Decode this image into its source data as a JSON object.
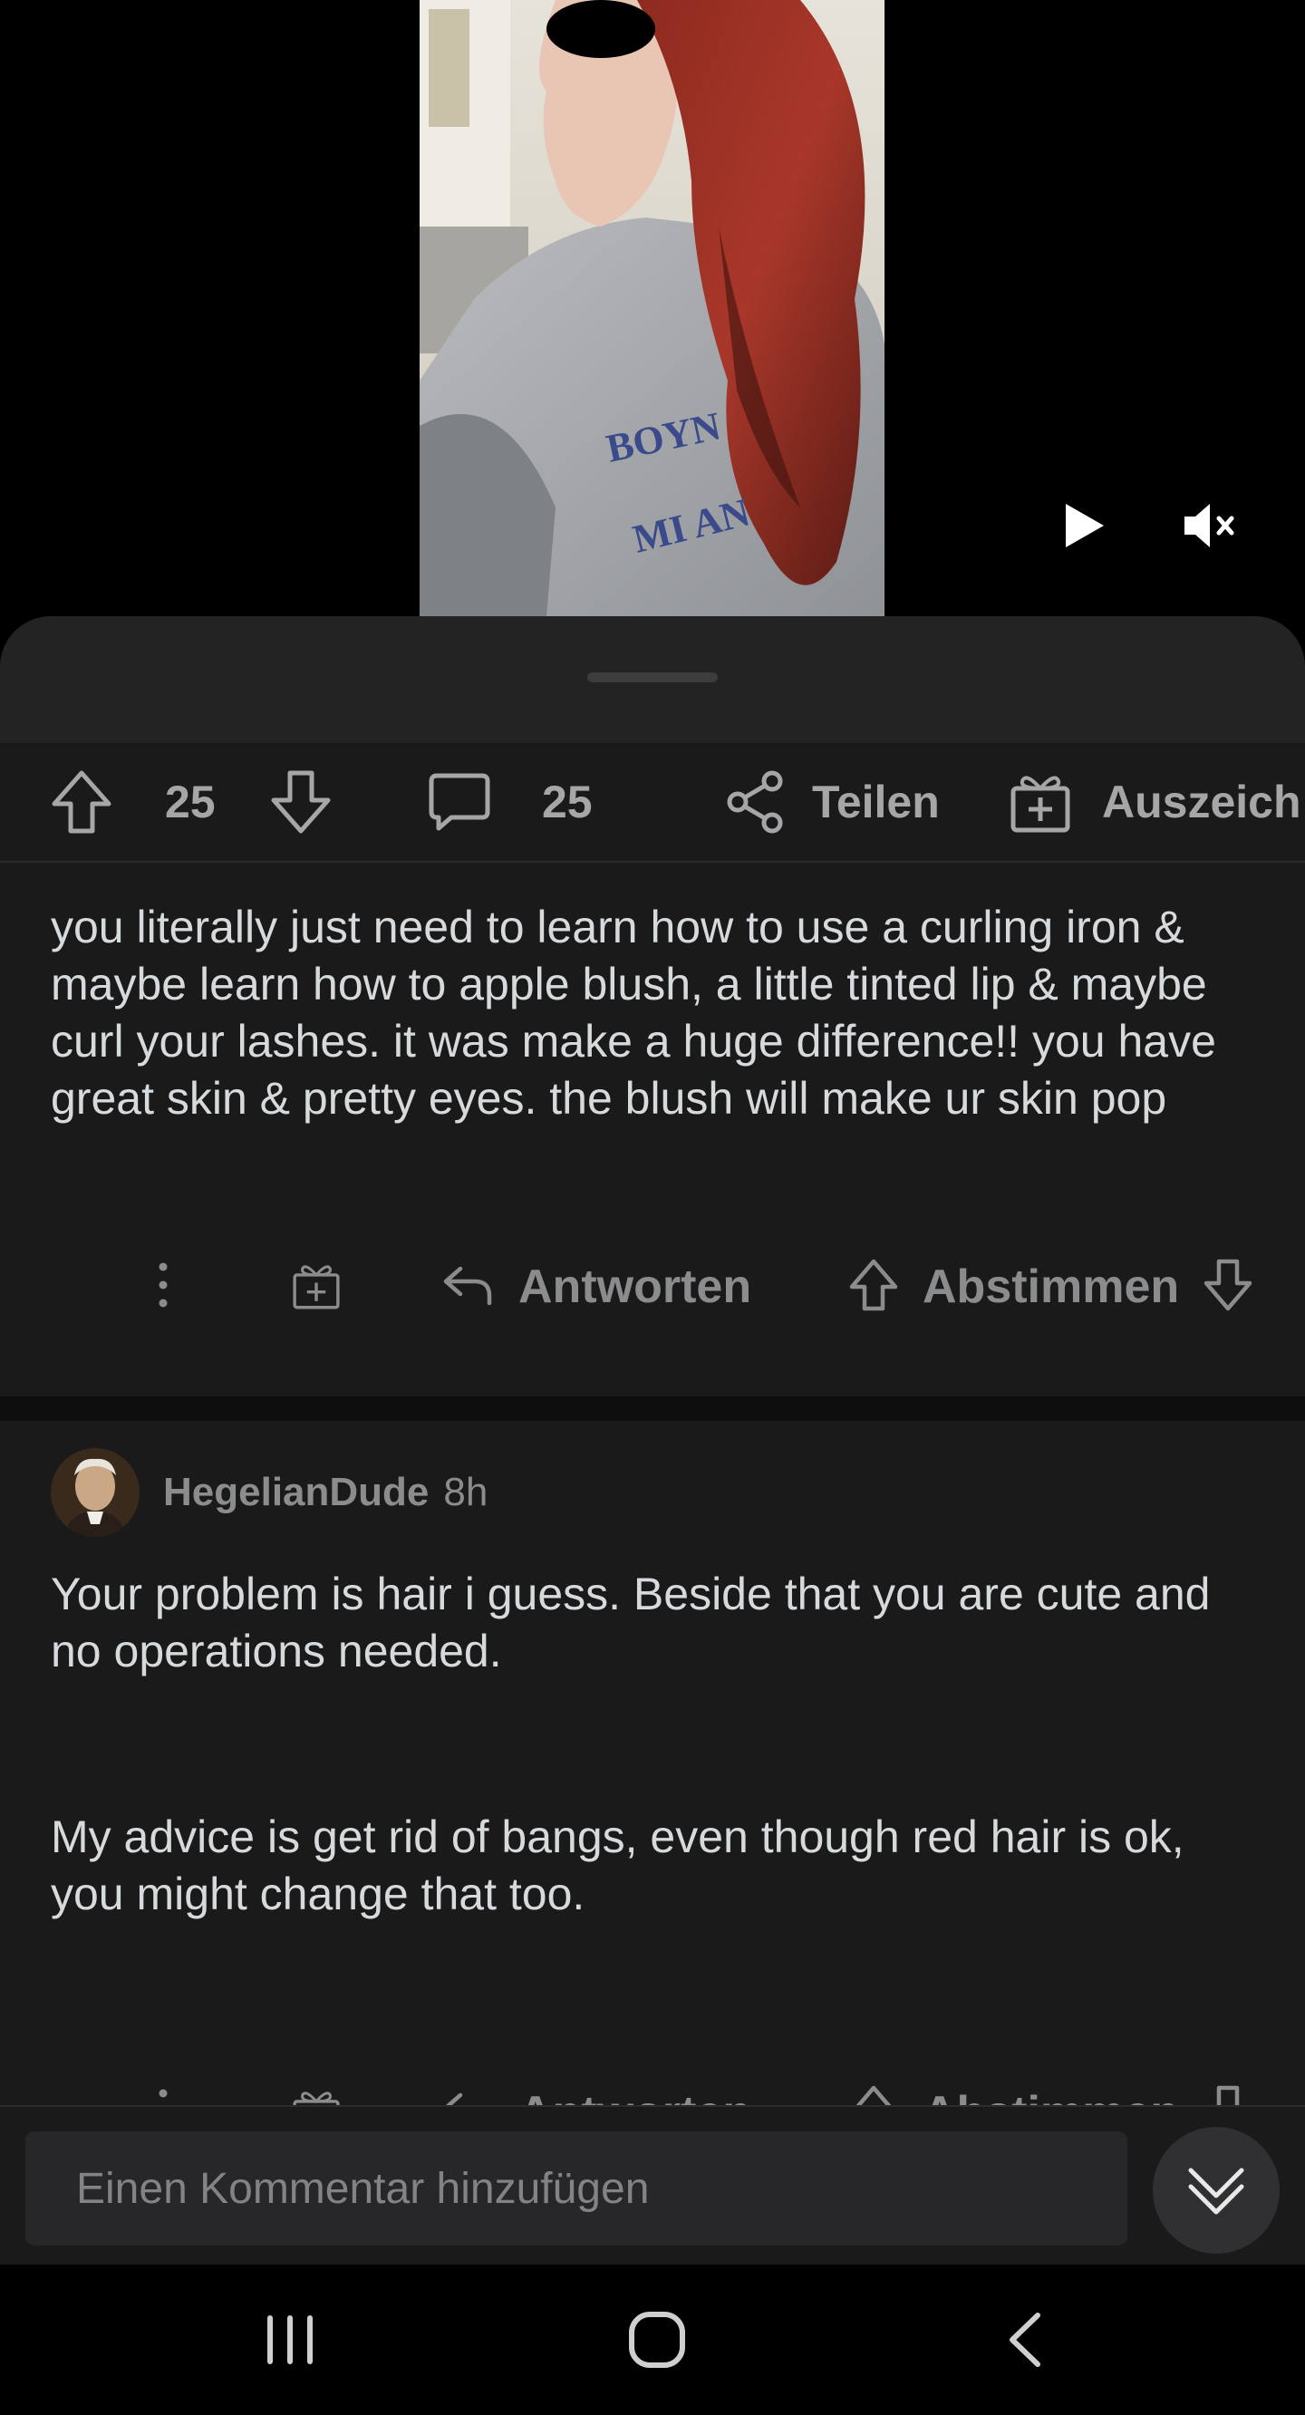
{
  "video": {
    "controls": {
      "play_icon": "play-icon",
      "mute_icon": "mute-icon"
    }
  },
  "action_bar": {
    "upvote_count": "25",
    "comment_count": "25",
    "share_label": "Teilen",
    "award_label": "Auszeich",
    "icons": [
      "upvote-icon",
      "downvote-icon",
      "comment-icon",
      "share-icon",
      "award-icon"
    ]
  },
  "comments": [
    {
      "username": "",
      "time": "",
      "body": [
        "you literally just need to learn how to use a curling iron & maybe learn how to apple blush, a little tinted lip & maybe curl your lashes. it was make a huge difference!! you have great skin & pretty eyes. the blush will make ur skin pop"
      ],
      "reply_label": "Antworten",
      "vote_label": "Abstimmen"
    },
    {
      "username": "HegelianDude",
      "time": "8h",
      "body": [
        "Your problem is hair i guess. Beside that you are cute and no operations needed.",
        "My advice is get rid of bangs, even though red hair is ok, you might change that too."
      ],
      "reply_label": "Antworten",
      "vote_label": "Abstimmen"
    }
  ],
  "compose": {
    "placeholder": "Einen Kommentar hinzufügen"
  },
  "colors": {
    "background": "#1a1a1b",
    "text": "#d7dadc",
    "muted": "#8a8c8e",
    "input_bg": "#272729"
  }
}
